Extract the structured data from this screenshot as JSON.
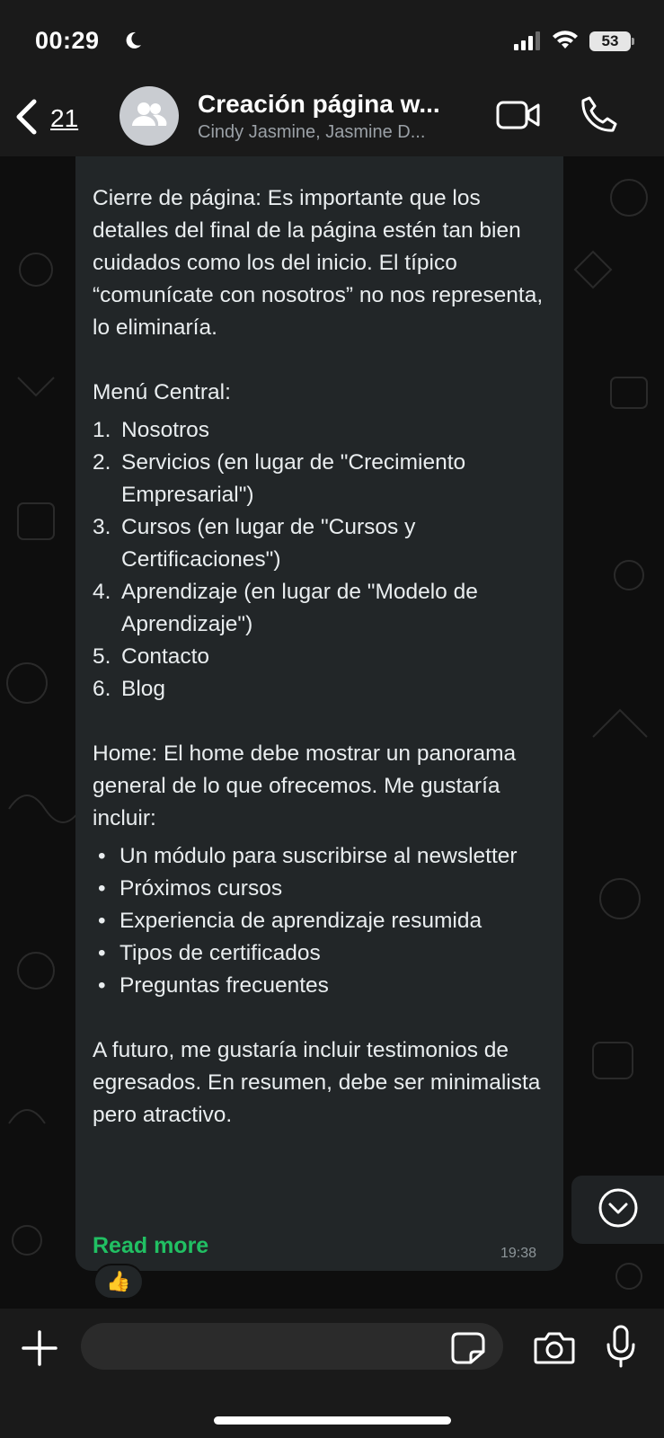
{
  "status_bar": {
    "time": "00:29",
    "battery": "53"
  },
  "header": {
    "back_count": "21",
    "title": "Creación página w...",
    "subtitle": "Cindy Jasmine, Jasmine D..."
  },
  "message": {
    "closing_paragraph": "Cierre de página: Es importante que los detalles del final de la página estén tan bien cuidados como los del inicio. El típico “comunícate con nosotros” no nos representa, lo eliminaría.",
    "menu_heading": "Menú Central:",
    "menu_items": [
      {
        "num": "1.",
        "text": "Nosotros"
      },
      {
        "num": "2.",
        "text": "Servicios (en lugar de \"Crecimiento Empresarial\")"
      },
      {
        "num": "3.",
        "text": "Cursos (en lugar de \"Cursos y Certificaciones\")"
      },
      {
        "num": "4.",
        "text": "Aprendizaje (en lugar de \"Modelo de Aprendizaje\")"
      },
      {
        "num": "5.",
        "text": "Contacto"
      },
      {
        "num": "6.",
        "text": "Blog"
      }
    ],
    "home_paragraph": "Home: El home debe mostrar un panorama general de lo que ofrecemos. Me gustaría incluir:",
    "home_items": [
      "Un módulo para suscribirse al newsletter",
      "Próximos cursos",
      "Experiencia de aprendizaje resumida",
      "Tipos de certificados",
      "Preguntas frecuentes"
    ],
    "future_paragraph": "A futuro, me gustaría incluir testimonios de egresados. En resumen, debe ser minimalista pero atractivo.",
    "read_more": "Read more",
    "time": "19:38",
    "reaction": "👍"
  },
  "colors": {
    "bubble": "#222628",
    "accent_green": "#21c063",
    "bar": "#1a1a1a"
  },
  "icons": [
    "moon-icon",
    "signal-icon",
    "wifi-icon",
    "back-chevron-icon",
    "group-avatar-icon",
    "video-call-icon",
    "phone-icon",
    "chevron-down-icon",
    "plus-icon",
    "sticker-icon",
    "camera-icon",
    "microphone-icon"
  ]
}
